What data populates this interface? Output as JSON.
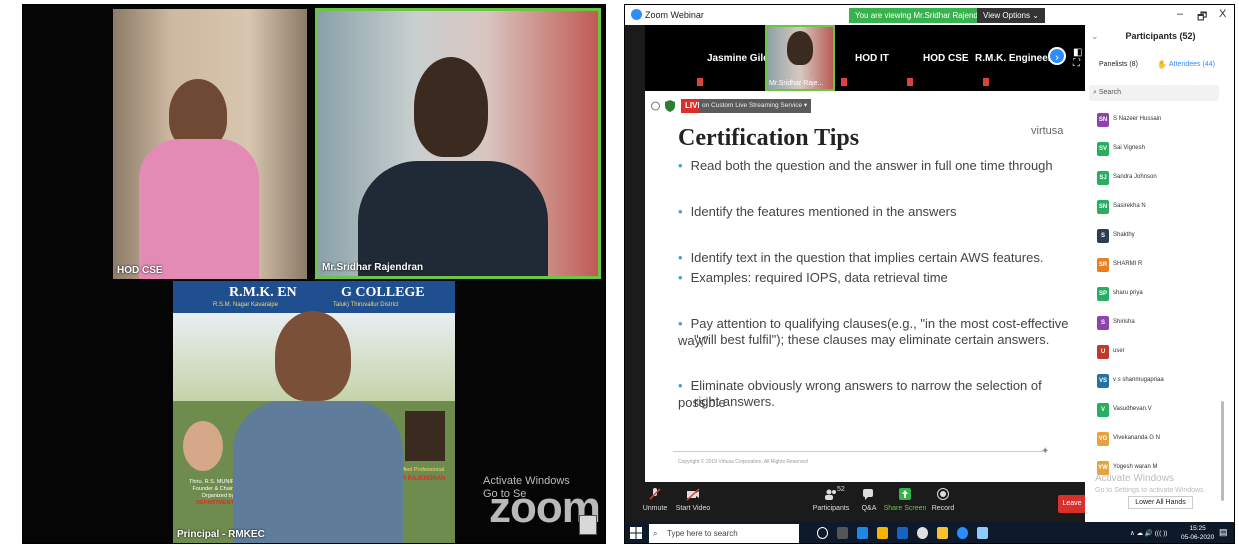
{
  "gallery": {
    "tile_hod_cse": {
      "name": "HOD CSE"
    },
    "tile_sridhar": {
      "name": "Mr.Sridhar Rajendran"
    },
    "tile_principal": {
      "name": "Principal - RMKEC",
      "banner_title": "R.M.K. EN",
      "banner_title_right": "G COLLEGE",
      "banner_sub": "R.S.M. Nagar Kavaraipe",
      "banner_sub_right": "Taluk) Thiruvallur District",
      "poster_person": "Thiru. R.S. MUNIRATHI",
      "poster_role": "Founder & Chairman",
      "poster_org": "Organized by",
      "poster_dept": "DEPARTMENT O",
      "poster_cert": "AWS Certified Professional",
      "poster_speaker": "HAR RAJENDRAN"
    },
    "watermark_line1": "Activate Windows",
    "watermark_line2": "Go to Se",
    "zoom_logo": "zoom"
  },
  "window": {
    "title": "Zoom Webinar",
    "viewing_banner": "You are viewing Mr.Sridhar Rajendran's screen",
    "view_options": "View Options ⌄",
    "minimize": "–",
    "maximize": "🗗",
    "close": "X"
  },
  "strip": {
    "participants": [
      "Jasmine Gilda",
      "HOD IT",
      "HOD CSE",
      "R.M.K. Engineer..."
    ],
    "active_thumb_name": "Mr.Sridhar Raje..."
  },
  "live": {
    "badge": "LIVE",
    "service": "on Custom Live Streaming Service ▾"
  },
  "slide": {
    "title": "Certification Tips",
    "brand": "virtusa",
    "bullets": [
      "Read both the question and the answer in full one time through",
      "Identify the features mentioned in the answers",
      "Identify text in the question that implies certain AWS features.",
      "Examples: required IOPS, data retrieval time",
      "Pay attention to qualifying clauses(e.g., \"in the most cost-effective way,\"",
      "\"will best fulfil\"); these clauses may eliminate certain answers.",
      "Eliminate obviously wrong answers to narrow the selection of possible",
      "right answers."
    ],
    "footer": "Copyright © 2019 Virtusa Corporation. All Rights Reserved"
  },
  "toolbar": {
    "unmute": "Unmute",
    "start_video": "Start Video",
    "participants": "Participants",
    "participants_count": "52",
    "qa": "Q&A",
    "share_screen": "Share Screen",
    "record": "Record",
    "leave": "Leave"
  },
  "panel": {
    "title": "Participants (52)",
    "back": "⌄",
    "tab_panelists": "Panelists (8)",
    "tab_attendees": "Attendees (44)",
    "search_placeholder": "Search",
    "attendees": [
      {
        "initials": "SN",
        "name": "S Nazeer Hussain",
        "color": "#8e44ad"
      },
      {
        "initials": "SV",
        "name": "Sai Vignesh",
        "color": "#27ae60"
      },
      {
        "initials": "SJ",
        "name": "Sandra Johnson",
        "color": "#27ae60"
      },
      {
        "initials": "SN",
        "name": "Sasirekha N",
        "color": "#27ae60"
      },
      {
        "initials": "S",
        "name": "Shakthy",
        "color": "#2c3e50"
      },
      {
        "initials": "SR",
        "name": "SHARMI R",
        "color": "#e67e22"
      },
      {
        "initials": "SP",
        "name": "sharu priya",
        "color": "#27ae60"
      },
      {
        "initials": "S",
        "name": "Shirisha",
        "color": "#8e44ad"
      },
      {
        "initials": "U",
        "name": "user",
        "color": "#c0392b"
      },
      {
        "initials": "VS",
        "name": "v s shanmugapriaa",
        "color": "#2471a3"
      },
      {
        "initials": "V",
        "name": "Vasudhevan.V",
        "color": "#27ae60"
      },
      {
        "initials": "VG",
        "name": "Vivekananda G N",
        "color": "#e6a23c"
      },
      {
        "initials": "YW",
        "name": "Yogesh waran M",
        "color": "#e6a23c"
      }
    ],
    "activate_line1": "Activate Windows",
    "activate_line2": "Go to Settings to activate Windows.",
    "lower_hands": "Lower All Hands"
  },
  "taskbar": {
    "search": "Type here to search",
    "time": "15:25",
    "date": "05-06-2020",
    "tray": "∧ ☁ 🔊 ((( ))"
  }
}
